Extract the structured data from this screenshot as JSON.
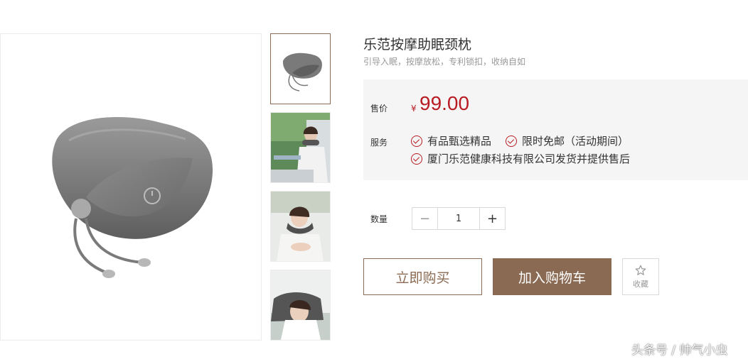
{
  "product": {
    "title": "乐范按摩助眠颈枕",
    "subtitle": "引导入眠，按摩放松，专利锁扣，收纳自如"
  },
  "pricing": {
    "label": "售价",
    "currency": "¥",
    "price": "99.00"
  },
  "services": {
    "label": "服务",
    "items": [
      "有品甄选精品",
      "限时免邮（活动期间）",
      "厦门乐范健康科技有限公司发货并提供售后"
    ]
  },
  "quantity": {
    "label": "数量",
    "value": "1",
    "minus": "−",
    "plus": "+"
  },
  "actions": {
    "buy_now": "立即购买",
    "add_to_cart": "加入购物车",
    "favorite": "收藏"
  },
  "watermark": "头条号 / 帅气小虫",
  "colors": {
    "accent": "#8a6a52",
    "price": "#b81c22",
    "panel_bg": "#f5f5f5"
  },
  "icons": [
    "check-icon",
    "star-icon",
    "minus-icon",
    "plus-icon"
  ]
}
